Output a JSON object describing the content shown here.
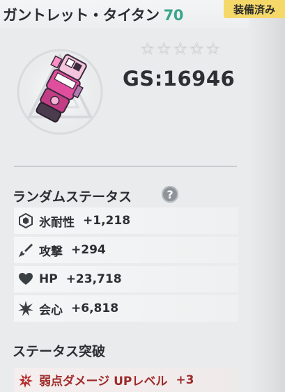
{
  "header": {
    "item_name": "ガントレット・タイタン",
    "level": "70",
    "equipped_label": "装備済み"
  },
  "item": {
    "stars": [
      "☆",
      "☆",
      "☆",
      "☆",
      "☆"
    ],
    "gear_score": "GS:16946"
  },
  "random_status": {
    "title": "ランダムステータス",
    "help": "?",
    "stats": [
      {
        "icon": "ice-crystal-icon",
        "name": "氷耐性",
        "value": "+1,218"
      },
      {
        "icon": "sword-icon",
        "name": "攻撃",
        "value": "+294"
      },
      {
        "icon": "heart-icon",
        "name": "HP",
        "value": "+23,718"
      },
      {
        "icon": "burst-icon",
        "name": "会心",
        "value": "+6,818"
      }
    ]
  },
  "status_break": {
    "title": "ステータス突破",
    "row": {
      "icon": "break-icon",
      "name": "弱点ダメージ UPレベル",
      "value": "+3"
    }
  },
  "colors": {
    "level": "#3aa58c",
    "badge": "#f5d86a",
    "break_text": "#9e2a2a"
  }
}
